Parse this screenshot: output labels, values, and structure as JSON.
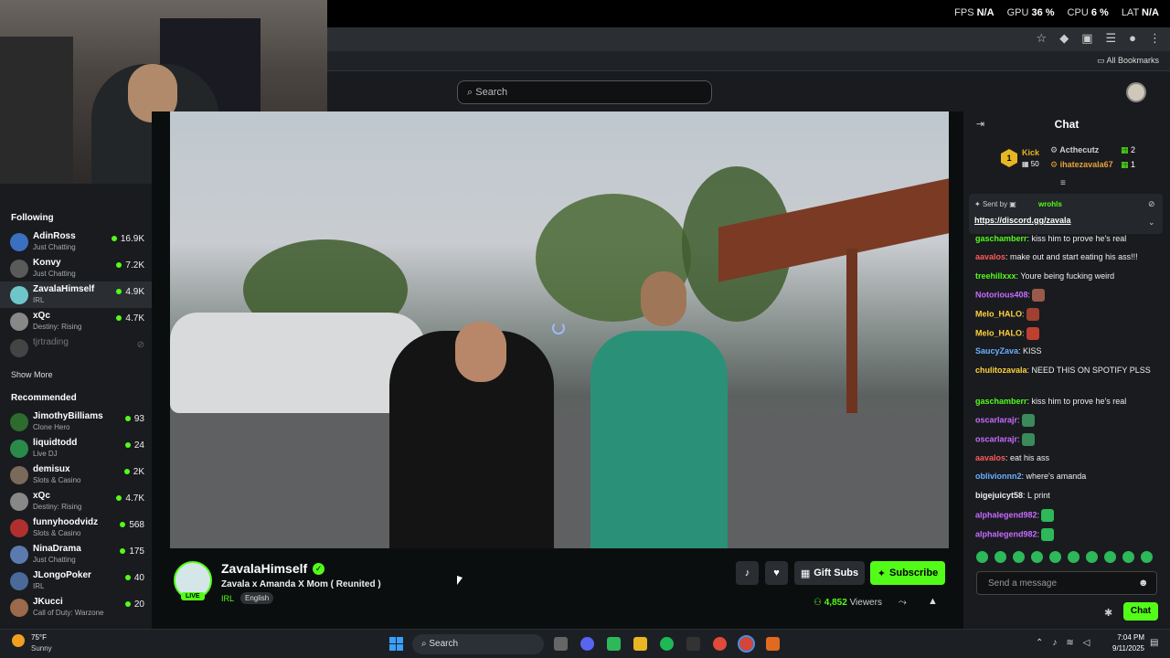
{
  "overlay": {
    "fps_label": "FPS",
    "fps_value": "N/A",
    "gpu_label": "GPU",
    "gpu_value": "36 %",
    "cpu_label": "CPU",
    "cpu_value": "6 %",
    "lat_label": "LAT",
    "lat_value": "N/A"
  },
  "browser": {
    "bookmarks_label": "All Bookmarks"
  },
  "header": {
    "search_placeholder": "Search"
  },
  "sidebar": {
    "following_title": "Following",
    "following": [
      {
        "name": "AdinRoss",
        "category": "Just Chatting",
        "viewers": "16.9K",
        "color": "#3b6fbf"
      },
      {
        "name": "Konvy",
        "category": "Just Chatting",
        "viewers": "7.2K",
        "color": "#5a5a5a"
      },
      {
        "name": "ZavalaHimself",
        "category": "IRL",
        "viewers": "4.9K",
        "color": "#6fc6c9"
      },
      {
        "name": "xQc",
        "category": "Destiny: Rising",
        "viewers": "4.7K",
        "color": "#888888"
      },
      {
        "name": "tjrtrading",
        "category": "",
        "viewers": "",
        "color": "#444444"
      }
    ],
    "show_more": "Show More",
    "recommended_title": "Recommended",
    "recommended": [
      {
        "name": "JimothyBilliams",
        "category": "Clone Hero",
        "viewers": "93",
        "color": "#2e6b2e"
      },
      {
        "name": "liquidtodd",
        "category": "Live DJ",
        "viewers": "24",
        "color": "#2a8a4a"
      },
      {
        "name": "demisux",
        "category": "Slots & Casino",
        "viewers": "2K",
        "color": "#7a6a5a"
      },
      {
        "name": "xQc",
        "category": "Destiny: Rising",
        "viewers": "4.7K",
        "color": "#888888"
      },
      {
        "name": "funnyhoodvidz",
        "category": "Slots & Casino",
        "viewers": "568",
        "color": "#b03030"
      },
      {
        "name": "NinaDrama",
        "category": "Just Chatting",
        "viewers": "175",
        "color": "#5a7ab0"
      },
      {
        "name": "JLongoPoker",
        "category": "IRL",
        "viewers": "40",
        "color": "#4a6a9a"
      },
      {
        "name": "JKucci",
        "category": "Call of Duty: Warzone",
        "viewers": "20",
        "color": "#9a6a4a"
      }
    ]
  },
  "stream": {
    "streamer": "ZavalaHimself",
    "title": "Zavala x Amanda X Mom ( Reunited )",
    "category": "IRL",
    "language": "English",
    "live_label": "LIVE",
    "viewers_count": "4,852",
    "viewers_label": "Viewers",
    "gift_label": "Gift Subs",
    "subscribe_label": "Subscribe"
  },
  "chat": {
    "title": "Chat",
    "leaderboard": {
      "kick_label": "Kick",
      "kick_value": "50",
      "entries": [
        {
          "user": "Acthecutz",
          "count": "2",
          "color": "#cfcfcf"
        },
        {
          "user": "ihatezavala67",
          "count": "1",
          "color": "#e8a03a"
        }
      ]
    },
    "pinned": {
      "sent_by_label": "Sent by",
      "user": "wrohls",
      "link": "https://discord.gg/zavala"
    },
    "messages": [
      {
        "user": "gaschamberr",
        "color": "#53fc18",
        "text": ": kiss him to prove he's real"
      },
      {
        "user": "aavalos",
        "color": "#ff5a5a",
        "text": ": make out and start eating his ass!!!"
      },
      {
        "user": "treehillxxx",
        "color": "#53fc18",
        "text": ": Youre being fucking weird"
      },
      {
        "user": "Notorious408",
        "color": "#c86bff",
        "text": ":",
        "emote": "#9a5a4a"
      },
      {
        "user": "Melo_HALO",
        "color": "#ffd23a",
        "text": ":",
        "emote": "#a04030"
      },
      {
        "user": "Melo_HALO",
        "color": "#ffd23a",
        "text": ":",
        "emote": "#c04030"
      },
      {
        "user": "SaucyZava",
        "color": "#6ab0ff",
        "text": ": KISS"
      },
      {
        "user": "chulitozavala",
        "color": "#ffd23a",
        "text": ": NEED THIS ON SPOTIFY PLSS"
      },
      {
        "user": "gaschamberr",
        "color": "#53fc18",
        "text": ": kiss him to prove he's real"
      },
      {
        "user": "oscarlarajr",
        "color": "#c86bff",
        "text": ":",
        "emote": "#3a8a5a"
      },
      {
        "user": "oscarlarajr",
        "color": "#c86bff",
        "text": ":",
        "emote": "#3a8a5a"
      },
      {
        "user": "aavalos",
        "color": "#ff5a5a",
        "text": ": eat his ass"
      },
      {
        "user": "oblivionnn2",
        "color": "#6ab0ff",
        "text": ": where's amanda"
      },
      {
        "user": "bigejuicyt58",
        "color": "#eeeeee",
        "text": ": L print"
      },
      {
        "user": "alphalegend982",
        "color": "#c86bff",
        "text": ":",
        "emote": "#2db85a"
      },
      {
        "user": "alphalegend982",
        "color": "#c86bff",
        "text": ":",
        "emote": "#2db85a"
      }
    ],
    "input_placeholder": "Send a message",
    "send_label": "Chat"
  },
  "taskbar": {
    "weather_temp": "75°F",
    "weather_desc": "Sunny",
    "search_label": "Search",
    "time": "7:04 PM",
    "date": "9/11/2025"
  }
}
